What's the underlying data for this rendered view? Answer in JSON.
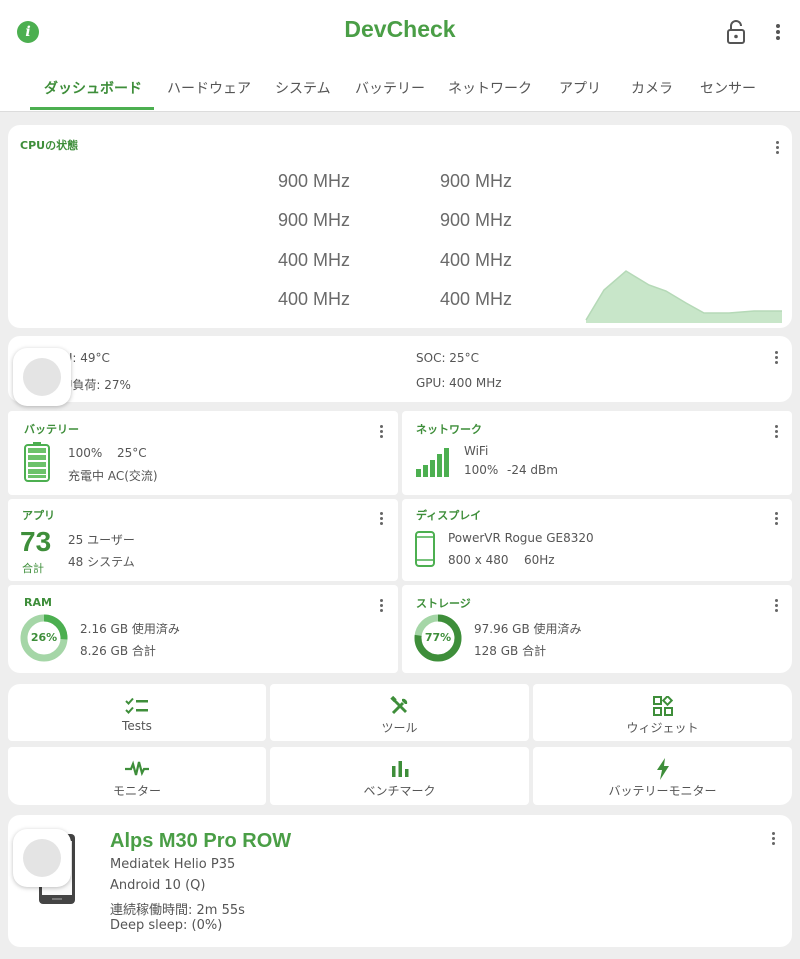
{
  "app": {
    "title": "DevCheck"
  },
  "colors": {
    "accent": "#4caf50",
    "accent_dark": "#3e8e3a",
    "chart_fill": "#c8e6c9"
  },
  "tabs": [
    {
      "label": "ダッシュボード",
      "active": true
    },
    {
      "label": "ハードウェア"
    },
    {
      "label": "システム"
    },
    {
      "label": "バッテリー"
    },
    {
      "label": "ネットワーク"
    },
    {
      "label": "アプリ"
    },
    {
      "label": "カメラ"
    },
    {
      "label": "センサー"
    }
  ],
  "cpu_status": {
    "title": "CPUの状態",
    "cores": [
      "900 MHz",
      "900 MHz",
      "900 MHz",
      "900 MHz",
      "400 MHz",
      "400 MHz",
      "400 MHz",
      "400 MHz"
    ]
  },
  "temps": {
    "cpu_temp": "CPU: 49°C",
    "cpu_load": "CPU負荷: 27%",
    "soc_temp": "SOC: 25°C",
    "gpu": "GPU: 400 MHz"
  },
  "battery": {
    "title": "バッテリー",
    "level": "100%",
    "temp": "25°C",
    "status": "充電中 AC(交流)"
  },
  "network": {
    "title": "ネットワーク",
    "type": "WiFi",
    "signal": "100%",
    "dbm": "-24 dBm"
  },
  "apps": {
    "title": "アプリ",
    "total": "73",
    "total_label": "合計",
    "user": "25 ユーザー",
    "system": "48 システム"
  },
  "display": {
    "title": "ディスプレイ",
    "gpu": "PowerVR Rogue GE8320",
    "resolution": "800 x 480",
    "refresh": "60Hz"
  },
  "ram": {
    "title": "RAM",
    "percent": "26%",
    "percent_value": 26,
    "used": "2.16 GB 使用済み",
    "total": "8.26 GB 合計"
  },
  "storage": {
    "title": "ストレージ",
    "percent": "77%",
    "percent_value": 77,
    "used": "97.96 GB 使用済み",
    "total": "128 GB 合計"
  },
  "buttons": {
    "tests": "Tests",
    "tools": "ツール",
    "widgets": "ウィジェット",
    "monitor": "モニター",
    "benchmark": "ベンチマーク",
    "battery_monitor": "バッテリーモニター"
  },
  "device": {
    "name": "Alps M30 Pro ROW",
    "soc": "Mediatek Helio P35",
    "android": "Android 10 (Q)",
    "uptime": "連続稼働時間: 2m 55s",
    "deep_sleep": "Deep sleep:  (0%)"
  }
}
